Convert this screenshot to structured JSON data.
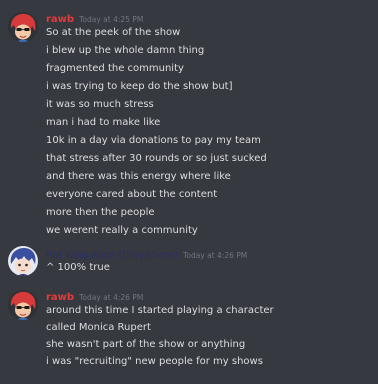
{
  "colors": {
    "background": "#36393f",
    "text": "#dcddde",
    "timestamp": "#72767d",
    "user_rawb": "#e03c3c",
    "user_ratking": "#2c2e6a"
  },
  "groups": [
    {
      "username": "rawb",
      "timestamp": "Today at 4:25 PM",
      "avatar_icon": "red-haired-character-avatar",
      "messages": [
        "So at the peek of the show",
        "i blew up the whole damn thing",
        "fragmented the community",
        "i was trying to keep do the show but]",
        "it was so much stress",
        "man i had to make like",
        "10k in a day via donations to pay my team",
        "that stress after 30 rounds or so just sucked",
        "and there was this energy where like",
        "everyone cared about the content",
        "more then the people",
        "we werent really a community"
      ]
    },
    {
      "username": "Rat King Alice (they/them)",
      "timestamp": "Today at 4:26 PM",
      "avatar_icon": "blue-haired-character-avatar",
      "messages": [
        "^ 100% true"
      ]
    },
    {
      "username": "rawb",
      "timestamp": "Today at 4:26 PM",
      "avatar_icon": "red-haired-character-avatar",
      "messages": [
        "around this time I started playing a character",
        "called Monica Rupert",
        "she wasn't part of the show or anything",
        "i was \"recruiting\" new people for my shows"
      ]
    }
  ]
}
